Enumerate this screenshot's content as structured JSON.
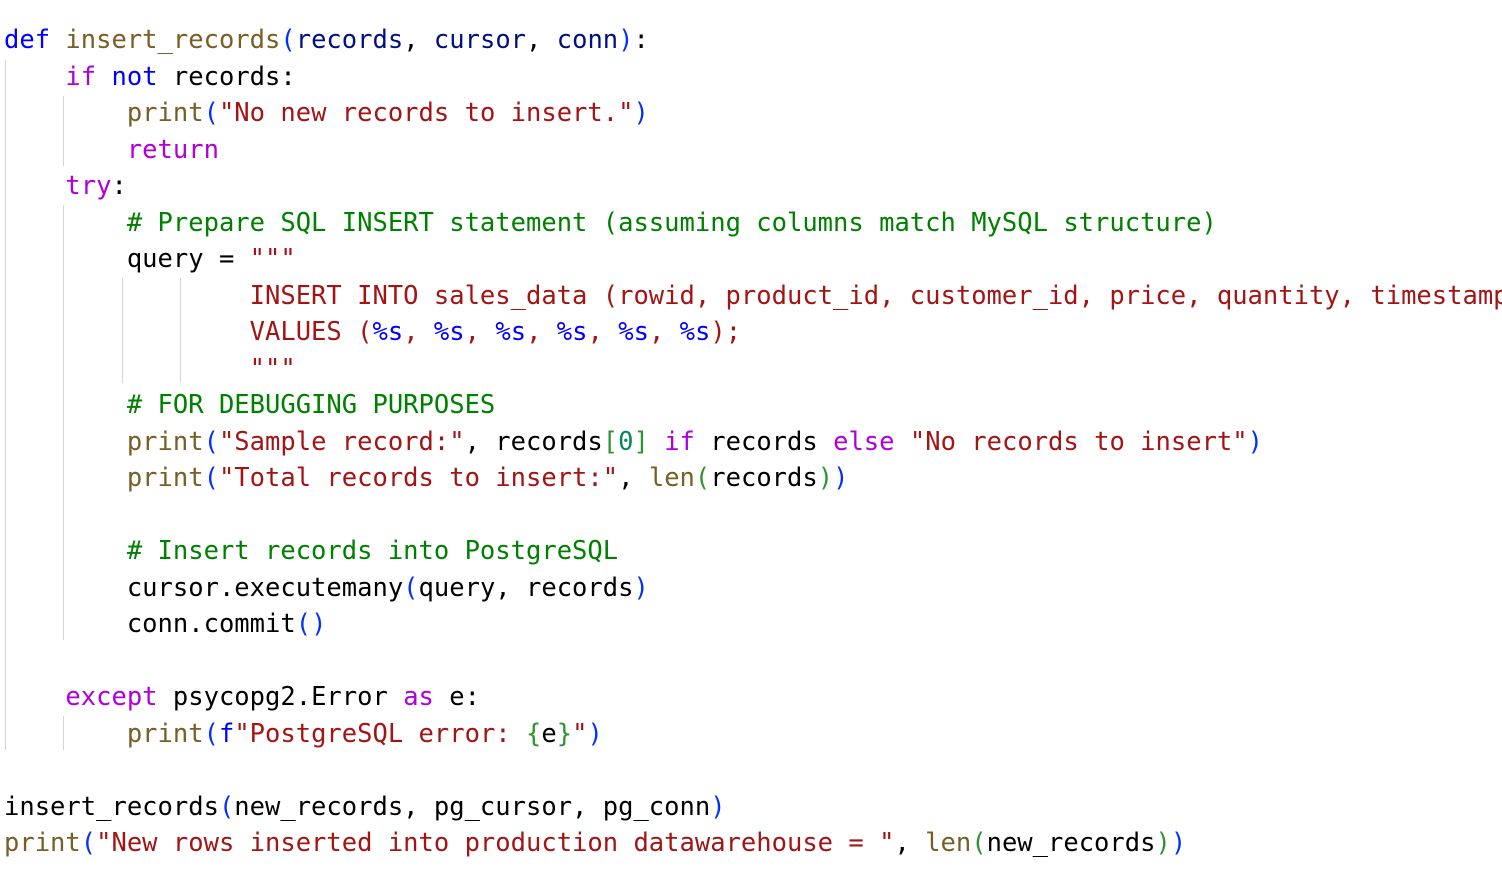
{
  "code": {
    "language": "python",
    "lines": [
      [
        [
          "kw",
          "def"
        ],
        [
          "plain",
          " "
        ],
        [
          "fn",
          "insert_records"
        ],
        [
          "paren1",
          "("
        ],
        [
          "id",
          "records"
        ],
        [
          "plain",
          ", "
        ],
        [
          "id",
          "cursor"
        ],
        [
          "plain",
          ", "
        ],
        [
          "id",
          "conn"
        ],
        [
          "paren1",
          ")"
        ],
        [
          "plain",
          ":"
        ]
      ],
      [
        [
          "plain",
          "    "
        ],
        [
          "ctl",
          "if"
        ],
        [
          "plain",
          " "
        ],
        [
          "kw",
          "not"
        ],
        [
          "plain",
          " "
        ],
        [
          "plain",
          "records:"
        ]
      ],
      [
        [
          "plain",
          "        "
        ],
        [
          "builtin",
          "print"
        ],
        [
          "paren1",
          "("
        ],
        [
          "str",
          "\"No new records to insert.\""
        ],
        [
          "paren1",
          ")"
        ]
      ],
      [
        [
          "plain",
          "        "
        ],
        [
          "ctl",
          "return"
        ]
      ],
      [
        [
          "plain",
          "    "
        ],
        [
          "ctl",
          "try"
        ],
        [
          "plain",
          ":"
        ]
      ],
      [
        [
          "plain",
          "        "
        ],
        [
          "cmt",
          "# Prepare SQL INSERT statement (assuming columns match MySQL structure)"
        ]
      ],
      [
        [
          "plain",
          "        "
        ],
        [
          "plain",
          "query = "
        ],
        [
          "str",
          "\"\"\""
        ]
      ],
      [
        [
          "plain",
          "                "
        ],
        [
          "str",
          "INSERT INTO sales_data (rowid, product_id, customer_id, price, quantity, timestamp)"
        ]
      ],
      [
        [
          "plain",
          "                "
        ],
        [
          "str",
          "VALUES ("
        ],
        [
          "ph",
          "%s"
        ],
        [
          "str",
          ", "
        ],
        [
          "ph",
          "%s"
        ],
        [
          "str",
          ", "
        ],
        [
          "ph",
          "%s"
        ],
        [
          "str",
          ", "
        ],
        [
          "ph",
          "%s"
        ],
        [
          "str",
          ", "
        ],
        [
          "ph",
          "%s"
        ],
        [
          "str",
          ", "
        ],
        [
          "ph",
          "%s"
        ],
        [
          "str",
          ");"
        ]
      ],
      [
        [
          "plain",
          "                "
        ],
        [
          "str",
          "\"\"\""
        ]
      ],
      [
        [
          "plain",
          "        "
        ],
        [
          "cmt",
          "# FOR DEBUGGING PURPOSES"
        ]
      ],
      [
        [
          "plain",
          "        "
        ],
        [
          "builtin",
          "print"
        ],
        [
          "paren1",
          "("
        ],
        [
          "str",
          "\"Sample record:\""
        ],
        [
          "plain",
          ", records"
        ],
        [
          "paren2",
          "["
        ],
        [
          "num",
          "0"
        ],
        [
          "paren2",
          "]"
        ],
        [
          "plain",
          " "
        ],
        [
          "ctl",
          "if"
        ],
        [
          "plain",
          " records "
        ],
        [
          "ctl",
          "else"
        ],
        [
          "plain",
          " "
        ],
        [
          "str",
          "\"No records to insert\""
        ],
        [
          "paren1",
          ")"
        ]
      ],
      [
        [
          "plain",
          "        "
        ],
        [
          "builtin",
          "print"
        ],
        [
          "paren1",
          "("
        ],
        [
          "str",
          "\"Total records to insert:\""
        ],
        [
          "plain",
          ", "
        ],
        [
          "builtin",
          "len"
        ],
        [
          "paren2",
          "("
        ],
        [
          "plain",
          "records"
        ],
        [
          "paren2",
          ")"
        ],
        [
          "paren1",
          ")"
        ]
      ],
      [],
      [
        [
          "plain",
          "        "
        ],
        [
          "cmt",
          "# Insert records into PostgreSQL"
        ]
      ],
      [
        [
          "plain",
          "        "
        ],
        [
          "plain",
          "cursor.executemany"
        ],
        [
          "paren1",
          "("
        ],
        [
          "plain",
          "query, records"
        ],
        [
          "paren1",
          ")"
        ]
      ],
      [
        [
          "plain",
          "        "
        ],
        [
          "plain",
          "conn.commit"
        ],
        [
          "paren1",
          "()"
        ]
      ],
      [],
      [
        [
          "plain",
          "    "
        ],
        [
          "ctl",
          "except"
        ],
        [
          "plain",
          " psycopg2.Error "
        ],
        [
          "ctl",
          "as"
        ],
        [
          "plain",
          " e:"
        ]
      ],
      [
        [
          "plain",
          "        "
        ],
        [
          "builtin",
          "print"
        ],
        [
          "paren1",
          "("
        ],
        [
          "kw",
          "f"
        ],
        [
          "str",
          "\"PostgreSQL error: "
        ],
        [
          "paren2",
          "{"
        ],
        [
          "plain",
          "e"
        ],
        [
          "paren2",
          "}"
        ],
        [
          "str",
          "\""
        ],
        [
          "paren1",
          ")"
        ]
      ],
      [],
      [
        [
          "plain",
          "insert_records"
        ],
        [
          "paren1",
          "("
        ],
        [
          "plain",
          "new_records, pg_cursor, pg_conn"
        ],
        [
          "paren1",
          ")"
        ]
      ],
      [
        [
          "builtin",
          "print"
        ],
        [
          "paren1",
          "("
        ],
        [
          "str",
          "\"New rows inserted into production datawarehouse = \""
        ],
        [
          "plain",
          ", "
        ],
        [
          "builtin",
          "len"
        ],
        [
          "paren2",
          "("
        ],
        [
          "plain",
          "new_records"
        ],
        [
          "paren2",
          ")"
        ],
        [
          "paren1",
          ")"
        ]
      ]
    ]
  }
}
